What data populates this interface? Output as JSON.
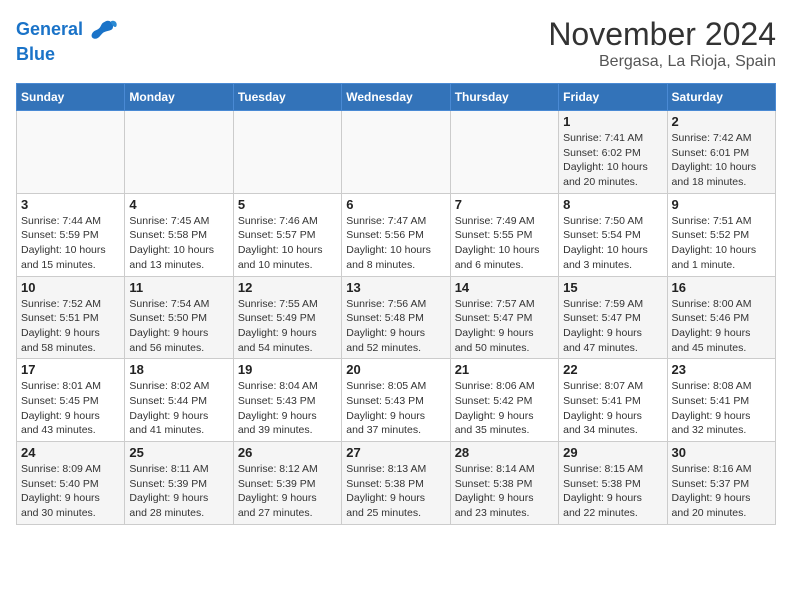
{
  "header": {
    "logo_line1": "General",
    "logo_line2": "Blue",
    "title": "November 2024",
    "subtitle": "Bergasa, La Rioja, Spain"
  },
  "weekdays": [
    "Sunday",
    "Monday",
    "Tuesday",
    "Wednesday",
    "Thursday",
    "Friday",
    "Saturday"
  ],
  "weeks": [
    [
      {
        "day": "",
        "info": ""
      },
      {
        "day": "",
        "info": ""
      },
      {
        "day": "",
        "info": ""
      },
      {
        "day": "",
        "info": ""
      },
      {
        "day": "",
        "info": ""
      },
      {
        "day": "1",
        "info": "Sunrise: 7:41 AM\nSunset: 6:02 PM\nDaylight: 10 hours\nand 20 minutes."
      },
      {
        "day": "2",
        "info": "Sunrise: 7:42 AM\nSunset: 6:01 PM\nDaylight: 10 hours\nand 18 minutes."
      }
    ],
    [
      {
        "day": "3",
        "info": "Sunrise: 7:44 AM\nSunset: 5:59 PM\nDaylight: 10 hours\nand 15 minutes."
      },
      {
        "day": "4",
        "info": "Sunrise: 7:45 AM\nSunset: 5:58 PM\nDaylight: 10 hours\nand 13 minutes."
      },
      {
        "day": "5",
        "info": "Sunrise: 7:46 AM\nSunset: 5:57 PM\nDaylight: 10 hours\nand 10 minutes."
      },
      {
        "day": "6",
        "info": "Sunrise: 7:47 AM\nSunset: 5:56 PM\nDaylight: 10 hours\nand 8 minutes."
      },
      {
        "day": "7",
        "info": "Sunrise: 7:49 AM\nSunset: 5:55 PM\nDaylight: 10 hours\nand 6 minutes."
      },
      {
        "day": "8",
        "info": "Sunrise: 7:50 AM\nSunset: 5:54 PM\nDaylight: 10 hours\nand 3 minutes."
      },
      {
        "day": "9",
        "info": "Sunrise: 7:51 AM\nSunset: 5:52 PM\nDaylight: 10 hours\nand 1 minute."
      }
    ],
    [
      {
        "day": "10",
        "info": "Sunrise: 7:52 AM\nSunset: 5:51 PM\nDaylight: 9 hours\nand 58 minutes."
      },
      {
        "day": "11",
        "info": "Sunrise: 7:54 AM\nSunset: 5:50 PM\nDaylight: 9 hours\nand 56 minutes."
      },
      {
        "day": "12",
        "info": "Sunrise: 7:55 AM\nSunset: 5:49 PM\nDaylight: 9 hours\nand 54 minutes."
      },
      {
        "day": "13",
        "info": "Sunrise: 7:56 AM\nSunset: 5:48 PM\nDaylight: 9 hours\nand 52 minutes."
      },
      {
        "day": "14",
        "info": "Sunrise: 7:57 AM\nSunset: 5:47 PM\nDaylight: 9 hours\nand 50 minutes."
      },
      {
        "day": "15",
        "info": "Sunrise: 7:59 AM\nSunset: 5:47 PM\nDaylight: 9 hours\nand 47 minutes."
      },
      {
        "day": "16",
        "info": "Sunrise: 8:00 AM\nSunset: 5:46 PM\nDaylight: 9 hours\nand 45 minutes."
      }
    ],
    [
      {
        "day": "17",
        "info": "Sunrise: 8:01 AM\nSunset: 5:45 PM\nDaylight: 9 hours\nand 43 minutes."
      },
      {
        "day": "18",
        "info": "Sunrise: 8:02 AM\nSunset: 5:44 PM\nDaylight: 9 hours\nand 41 minutes."
      },
      {
        "day": "19",
        "info": "Sunrise: 8:04 AM\nSunset: 5:43 PM\nDaylight: 9 hours\nand 39 minutes."
      },
      {
        "day": "20",
        "info": "Sunrise: 8:05 AM\nSunset: 5:43 PM\nDaylight: 9 hours\nand 37 minutes."
      },
      {
        "day": "21",
        "info": "Sunrise: 8:06 AM\nSunset: 5:42 PM\nDaylight: 9 hours\nand 35 minutes."
      },
      {
        "day": "22",
        "info": "Sunrise: 8:07 AM\nSunset: 5:41 PM\nDaylight: 9 hours\nand 34 minutes."
      },
      {
        "day": "23",
        "info": "Sunrise: 8:08 AM\nSunset: 5:41 PM\nDaylight: 9 hours\nand 32 minutes."
      }
    ],
    [
      {
        "day": "24",
        "info": "Sunrise: 8:09 AM\nSunset: 5:40 PM\nDaylight: 9 hours\nand 30 minutes."
      },
      {
        "day": "25",
        "info": "Sunrise: 8:11 AM\nSunset: 5:39 PM\nDaylight: 9 hours\nand 28 minutes."
      },
      {
        "day": "26",
        "info": "Sunrise: 8:12 AM\nSunset: 5:39 PM\nDaylight: 9 hours\nand 27 minutes."
      },
      {
        "day": "27",
        "info": "Sunrise: 8:13 AM\nSunset: 5:38 PM\nDaylight: 9 hours\nand 25 minutes."
      },
      {
        "day": "28",
        "info": "Sunrise: 8:14 AM\nSunset: 5:38 PM\nDaylight: 9 hours\nand 23 minutes."
      },
      {
        "day": "29",
        "info": "Sunrise: 8:15 AM\nSunset: 5:38 PM\nDaylight: 9 hours\nand 22 minutes."
      },
      {
        "day": "30",
        "info": "Sunrise: 8:16 AM\nSunset: 5:37 PM\nDaylight: 9 hours\nand 20 minutes."
      }
    ]
  ]
}
